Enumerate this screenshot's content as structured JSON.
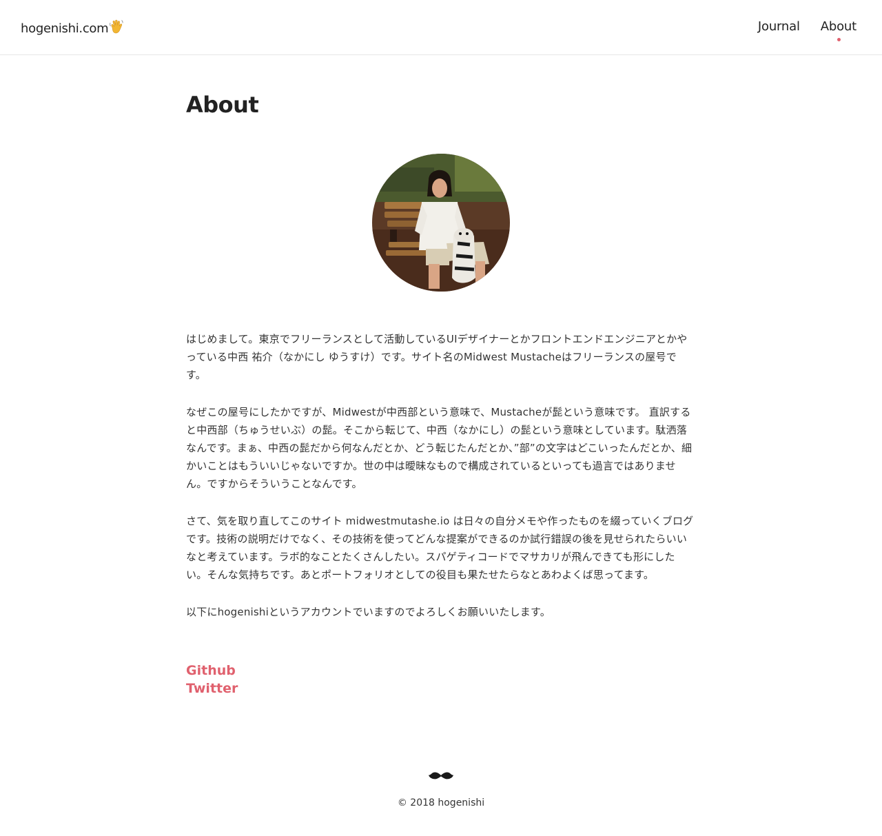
{
  "colors": {
    "accent": "#e0616e",
    "text": "#333333",
    "heading": "#222222",
    "border": "#e6e6e6"
  },
  "header": {
    "brand": "hogenishi.com",
    "brand_icon": "waving-hand-icon",
    "nav": [
      {
        "label": "Journal",
        "active": false
      },
      {
        "label": "About",
        "active": true
      }
    ]
  },
  "page": {
    "title": "About",
    "paragraphs": [
      "はじめまして。東京でフリーランスとして活動しているUIデザイナーとかフロントエンドエンジニアとかやっている中西 祐介（なかにし ゆうすけ）です。サイト名のMidwest Mustacheはフリーランスの屋号です。",
      "なぜこの屋号にしたかですが、Midwestが中西部という意味で、Mustacheが髭という意味です。 直訳すると中西部（ちゅうせいぶ）の髭。そこから転じて、中西（なかにし）の髭という意味としています。駄洒落なんです。まぁ、中西の髭だから何なんだとか、どう転じたんだとか、”部”の文字はどこいったんだとか、細かいことはもういいじゃないですか。世の中は曖昧なもので構成されているといっても過言ではありません。ですからそういうことなんです。",
      "さて、気を取り直してこのサイト midwestmutashe.io は日々の自分メモや作ったものを綴っていくブログです。技術の説明だけでなく、その技術を使ってどんな提案ができるのか試行錯誤の後を見せられたらいいなと考えています。ラボ的なことたくさんしたい。スパゲティコードでマサカリが飛んできても形にしたい。そんな気持ちです。あとポートフォリオとしての役目も果たせたらなとあわよくば思ってます。",
      "以下にhogenishiというアカウントでいますのでよろしくお願いいたします。"
    ],
    "links": [
      "Github",
      "Twitter"
    ]
  },
  "footer": {
    "icon": "mustache-icon",
    "copyright": "© 2018 hogenishi"
  }
}
